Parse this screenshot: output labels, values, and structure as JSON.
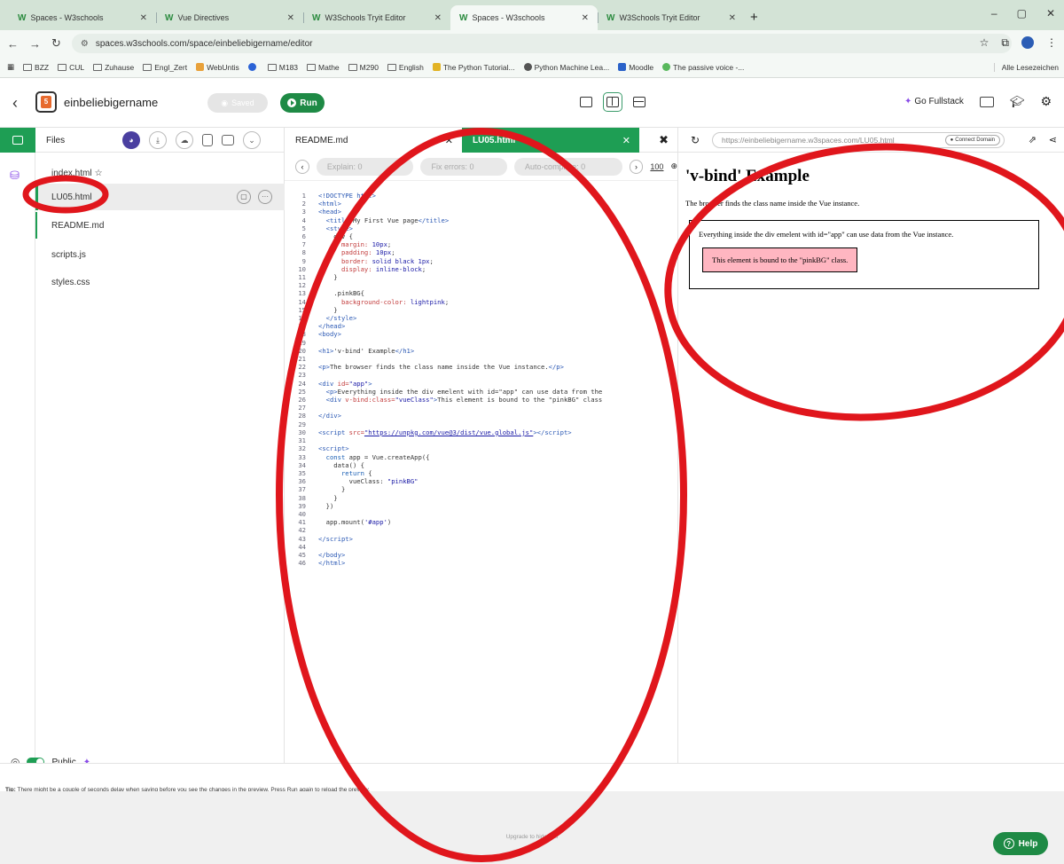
{
  "browser": {
    "tabs": [
      {
        "label": "Spaces - W3schools",
        "active": false
      },
      {
        "label": "Vue Directives",
        "active": false
      },
      {
        "label": "W3Schools Tryit Editor",
        "active": false
      },
      {
        "label": "Spaces - W3schools",
        "active": true
      },
      {
        "label": "W3Schools Tryit Editor",
        "active": false
      }
    ],
    "tab_brand": "W",
    "new_tab": "+",
    "window_controls": [
      "–",
      "▢",
      "✕"
    ],
    "url": "spaces.w3schools.com/space/einbeliebigername/editor",
    "bookmarks": [
      "BZZ",
      "CUL",
      "Zuhause",
      "Engl_Zert",
      "WebUntis",
      "M183",
      "Mathe",
      "M290",
      "English",
      "The Python Tutorial...",
      "Python Machine Lea...",
      "Moodle",
      "The passive voice -..."
    ],
    "all_bookmarks": "Alle Lesezeichen"
  },
  "app": {
    "space_name": "einbeliebigername",
    "saved_label": "Saved",
    "run_label": "Run",
    "go_fullstack": "Go Fullstack"
  },
  "files": {
    "header": "Files",
    "items": [
      "index.html",
      "LU05.html",
      "README.md",
      "scripts.js",
      "styles.css"
    ],
    "selected": "LU05.html",
    "public_label": "Public"
  },
  "editor": {
    "tabs": [
      "README.md",
      "LU05.html"
    ],
    "ai": {
      "explain": "Explain: 0",
      "fix": "Fix errors: 0",
      "autocomplete": "Auto-complete: 0",
      "count": "100"
    },
    "code": [
      [
        1,
        [
          [
            "t",
            "<!DOCTYPE html>"
          ]
        ]
      ],
      [
        2,
        [
          [
            "t",
            "<html>"
          ]
        ]
      ],
      [
        3,
        [
          [
            "t",
            "<head>"
          ]
        ]
      ],
      [
        4,
        [
          [
            "t",
            "  <title>"
          ],
          [
            "x",
            "My First Vue page"
          ],
          [
            "t",
            "</title>"
          ]
        ]
      ],
      [
        5,
        [
          [
            "t",
            "  <style>"
          ]
        ]
      ],
      [
        6,
        [
          [
            "x",
            "    div {"
          ]
        ]
      ],
      [
        7,
        [
          [
            "a",
            "      margin: "
          ],
          [
            "s",
            "10px"
          ],
          [
            "x",
            ";"
          ]
        ]
      ],
      [
        8,
        [
          [
            "a",
            "      padding: "
          ],
          [
            "s",
            "10px"
          ],
          [
            "x",
            ";"
          ]
        ]
      ],
      [
        9,
        [
          [
            "a",
            "      border: "
          ],
          [
            "s",
            "solid black 1px"
          ],
          [
            "x",
            ";"
          ]
        ]
      ],
      [
        10,
        [
          [
            "a",
            "      display: "
          ],
          [
            "s",
            "inline-block"
          ],
          [
            "x",
            ";"
          ]
        ]
      ],
      [
        11,
        [
          [
            "x",
            "    }"
          ]
        ]
      ],
      [
        12,
        [
          [
            "x",
            ""
          ]
        ]
      ],
      [
        13,
        [
          [
            "x",
            "    .pinkBG{"
          ]
        ]
      ],
      [
        14,
        [
          [
            "a",
            "      background-color: "
          ],
          [
            "s",
            "lightpink"
          ],
          [
            "x",
            ";"
          ]
        ]
      ],
      [
        15,
        [
          [
            "x",
            "    }"
          ]
        ]
      ],
      [
        16,
        [
          [
            "t",
            "  </style>"
          ]
        ]
      ],
      [
        17,
        [
          [
            "t",
            "</head>"
          ]
        ]
      ],
      [
        18,
        [
          [
            "t",
            "<body>"
          ]
        ]
      ],
      [
        19,
        [
          [
            "x",
            ""
          ]
        ]
      ],
      [
        20,
        [
          [
            "t",
            "<h1>"
          ],
          [
            "x",
            "'v-bind' Example"
          ],
          [
            "t",
            "</h1>"
          ]
        ]
      ],
      [
        21,
        [
          [
            "x",
            ""
          ]
        ]
      ],
      [
        22,
        [
          [
            "t",
            "<p>"
          ],
          [
            "x",
            "The browser finds the class name inside the Vue instance."
          ],
          [
            "t",
            "</p>"
          ]
        ]
      ],
      [
        23,
        [
          [
            "x",
            ""
          ]
        ]
      ],
      [
        24,
        [
          [
            "t",
            "<div "
          ],
          [
            "a",
            "id="
          ],
          [
            "s",
            "\"app\""
          ],
          [
            "t",
            ">"
          ]
        ]
      ],
      [
        25,
        [
          [
            "t",
            "  <p>"
          ],
          [
            "x",
            "Everything inside the div emelent with id=\"app\" can use data from the"
          ]
        ]
      ],
      [
        26,
        [
          [
            "t",
            "  <div "
          ],
          [
            "a",
            "v-bind:class="
          ],
          [
            "s",
            "\"vueClass\""
          ],
          [
            "t",
            ">"
          ],
          [
            "x",
            "This element is bound to the \"pinkBG\" class"
          ]
        ]
      ],
      [
        27,
        [
          [
            "x",
            ""
          ]
        ]
      ],
      [
        28,
        [
          [
            "t",
            "</div>"
          ]
        ]
      ],
      [
        29,
        [
          [
            "x",
            ""
          ]
        ]
      ],
      [
        30,
        [
          [
            "t",
            "<script "
          ],
          [
            "a",
            "src="
          ],
          [
            "u",
            "\"https://unpkg.com/vue@3/dist/vue.global.js\""
          ],
          [
            "t",
            "></"
          ],
          [
            "t",
            "script>"
          ]
        ]
      ],
      [
        31,
        [
          [
            "x",
            ""
          ]
        ]
      ],
      [
        32,
        [
          [
            "t",
            "<script>"
          ]
        ]
      ],
      [
        33,
        [
          [
            "k",
            "  const"
          ],
          [
            "x",
            " app = Vue.createApp({"
          ]
        ]
      ],
      [
        34,
        [
          [
            "x",
            "    data() {"
          ]
        ]
      ],
      [
        35,
        [
          [
            "k",
            "      return"
          ],
          [
            "x",
            " {"
          ]
        ]
      ],
      [
        36,
        [
          [
            "x",
            "        vueClass: "
          ],
          [
            "s",
            "\"pinkBG\""
          ]
        ]
      ],
      [
        37,
        [
          [
            "x",
            "      }"
          ]
        ]
      ],
      [
        38,
        [
          [
            "x",
            "    }"
          ]
        ]
      ],
      [
        39,
        [
          [
            "x",
            "  })"
          ]
        ]
      ],
      [
        40,
        [
          [
            "x",
            ""
          ]
        ]
      ],
      [
        41,
        [
          [
            "x",
            "  app.mount("
          ],
          [
            "s",
            "'#app'"
          ],
          [
            "x",
            ")"
          ]
        ]
      ],
      [
        42,
        [
          [
            "x",
            ""
          ]
        ]
      ],
      [
        43,
        [
          [
            "t",
            "</"
          ],
          [
            "t",
            "script>"
          ]
        ]
      ],
      [
        44,
        [
          [
            "x",
            ""
          ]
        ]
      ],
      [
        45,
        [
          [
            "t",
            "</body>"
          ]
        ]
      ],
      [
        46,
        [
          [
            "t",
            "</html>"
          ]
        ]
      ]
    ]
  },
  "preview": {
    "url": "https://einbeliebigername.w3spaces.com/LU05.html",
    "connect_domain": "Connect Domain",
    "h1": "'v-bind' Example",
    "intro": "The browser finds the class name inside the Vue instance.",
    "app_text": "Everything inside the div emelent with id=\"app\" can use data from the Vue instance.",
    "pink_text": "This element is bound to the \"pinkBG\" class."
  },
  "tip": {
    "label": "Tip:",
    "text": "There might be a couple of seconds delay when saving before you see the changes in the preview. Press Run again to reload the preview."
  },
  "footer": {
    "upgrade": "Upgrade to hide ads",
    "help": "Help"
  },
  "colors": {
    "brand_green": "#1e9e54",
    "annotation_red": "#e0161c",
    "pink_bg": "#ffb6c1"
  }
}
